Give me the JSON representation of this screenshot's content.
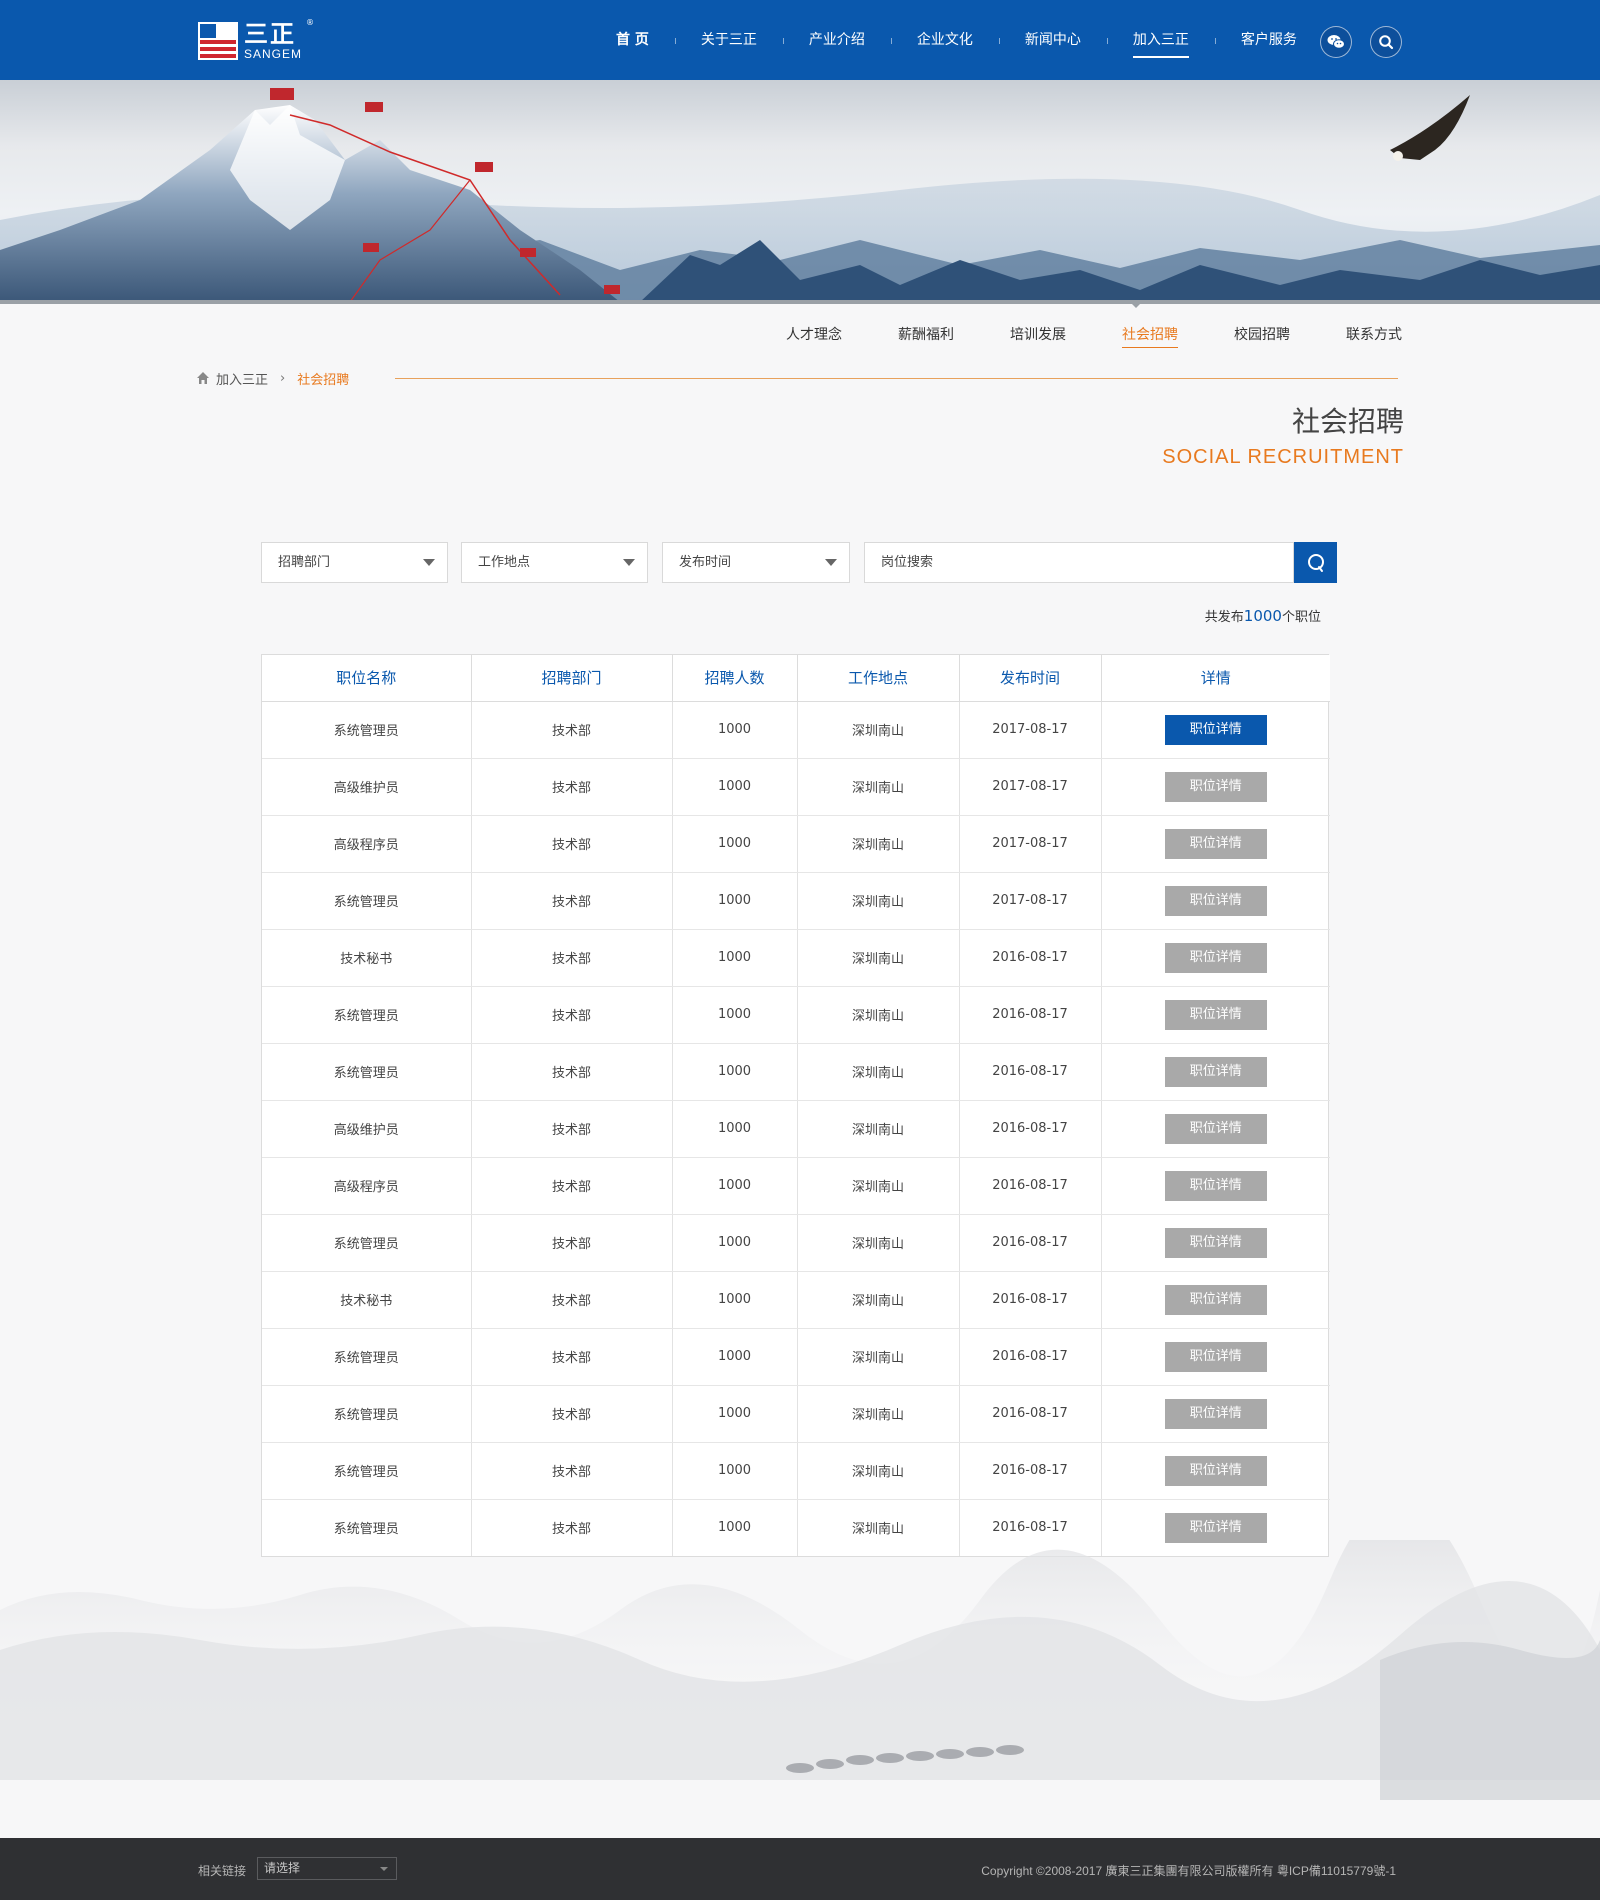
{
  "header": {
    "logo_cn": "三正",
    "logo_en": "SANGEM",
    "logo_reg": "®",
    "nav": [
      "首 页",
      "关于三正",
      "产业介绍",
      "企业文化",
      "新闻中心",
      "加入三正",
      "客户服务"
    ],
    "active_nav": "加入三正"
  },
  "subnav": {
    "items": [
      "人才理念",
      "薪酬福利",
      "培训发展",
      "社会招聘",
      "校园招聘",
      "联系方式"
    ],
    "active": "社会招聘"
  },
  "breadcrumb": {
    "parent": "加入三正",
    "sep": "›",
    "current": "社会招聘"
  },
  "section": {
    "title_cn": "社会招聘",
    "title_en": "SOCIAL RECRUITMENT"
  },
  "filters": {
    "department": "招聘部门",
    "location": "工作地点",
    "publish_time": "发布时间",
    "search_placeholder": "岗位搜索"
  },
  "count": {
    "prefix": "共发布",
    "number": "1000",
    "suffix": "个职位"
  },
  "table": {
    "headers": [
      "职位名称",
      "招聘部门",
      "招聘人数",
      "工作地点",
      "发布时间",
      "详情"
    ],
    "detail_label": "职位详情",
    "rows": [
      [
        "系统管理员",
        "技术部",
        "1000",
        "深圳南山",
        "2017-08-17"
      ],
      [
        "高级维护员",
        "技术部",
        "1000",
        "深圳南山",
        "2017-08-17"
      ],
      [
        "高级程序员",
        "技术部",
        "1000",
        "深圳南山",
        "2017-08-17"
      ],
      [
        "系统管理员",
        "技术部",
        "1000",
        "深圳南山",
        "2017-08-17"
      ],
      [
        "技术秘书",
        "技术部",
        "1000",
        "深圳南山",
        "2016-08-17"
      ],
      [
        "系统管理员",
        "技术部",
        "1000",
        "深圳南山",
        "2016-08-17"
      ],
      [
        "系统管理员",
        "技术部",
        "1000",
        "深圳南山",
        "2016-08-17"
      ],
      [
        "高级维护员",
        "技术部",
        "1000",
        "深圳南山",
        "2016-08-17"
      ],
      [
        "高级程序员",
        "技术部",
        "1000",
        "深圳南山",
        "2016-08-17"
      ],
      [
        "系统管理员",
        "技术部",
        "1000",
        "深圳南山",
        "2016-08-17"
      ],
      [
        "技术秘书",
        "技术部",
        "1000",
        "深圳南山",
        "2016-08-17"
      ],
      [
        "系统管理员",
        "技术部",
        "1000",
        "深圳南山",
        "2016-08-17"
      ],
      [
        "系统管理员",
        "技术部",
        "1000",
        "深圳南山",
        "2016-08-17"
      ],
      [
        "系统管理员",
        "技术部",
        "1000",
        "深圳南山",
        "2016-08-17"
      ],
      [
        "系统管理员",
        "技术部",
        "1000",
        "深圳南山",
        "2016-08-17"
      ]
    ]
  },
  "footer": {
    "links_label": "相关链接",
    "links_select": "请选择",
    "copyright": "Copyright ©2008-2017  廣東三正集團有限公司版權所有   粵ICP備11015779號-1"
  },
  "colors": {
    "brand_blue": "#0a58ad",
    "accent_orange": "#e87a1f",
    "button_gray": "#a9a9a9",
    "footer_bg": "#2f3033"
  }
}
